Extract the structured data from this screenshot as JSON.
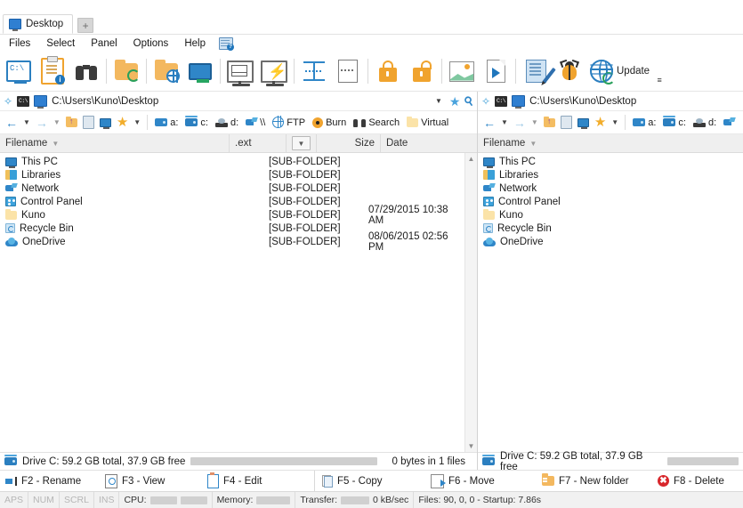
{
  "window": {
    "tab_label": "Desktop",
    "new_tab_label": "+"
  },
  "menu": {
    "items": [
      {
        "label": "Files",
        "name": "menu-files"
      },
      {
        "label": "Select",
        "name": "menu-select"
      },
      {
        "label": "Panel",
        "name": "menu-panel"
      },
      {
        "label": "Options",
        "name": "menu-options"
      },
      {
        "label": "Help",
        "name": "menu-help"
      }
    ],
    "help_icon": "help-sheet-icon"
  },
  "toolbar": {
    "update_label": "Update",
    "overflow_label": "≡",
    "buttons": [
      {
        "name": "command-prompt-button",
        "icon": "command-prompt-icon",
        "label": "C:\\"
      },
      {
        "name": "clipboard-info-button",
        "icon": "clipboard-info-icon"
      },
      {
        "name": "binoculars-search-button",
        "icon": "binoculars-icon"
      },
      {
        "name": "folder-sync-button",
        "icon": "folder-sync-icon"
      },
      {
        "name": "folder-network-button",
        "icon": "folder-globe-icon"
      },
      {
        "name": "network-computer-button",
        "icon": "monitor-network-icon"
      },
      {
        "name": "pack-mail-button",
        "icon": "envelope-clamp-icon"
      },
      {
        "name": "pack-fast-button",
        "icon": "bolt-clamp-icon"
      },
      {
        "name": "split-file-button",
        "icon": "split-horizontal-icon"
      },
      {
        "name": "combine-file-button",
        "icon": "combine-document-icon"
      },
      {
        "name": "encrypt-button",
        "icon": "lock-closed-icon"
      },
      {
        "name": "decrypt-button",
        "icon": "lock-open-icon"
      },
      {
        "name": "image-viewer-button",
        "icon": "picture-icon"
      },
      {
        "name": "media-player-button",
        "icon": "page-play-icon"
      },
      {
        "name": "editor-button",
        "icon": "document-pencil-icon"
      },
      {
        "name": "debug-button",
        "icon": "bug-icon"
      },
      {
        "name": "update-button",
        "icon": "globe-refresh-icon"
      }
    ]
  },
  "panels": {
    "left": {
      "address": {
        "path": "C:\\Users\\Kuno\\Desktop",
        "cmd_badge": "C:\\",
        "dropdown_icon": "chevron-down-icon",
        "favorite_icon": "star-icon",
        "search_icon": "magnifier-icon"
      },
      "nav": {
        "back_icon": "arrow-left-icon",
        "forward_icon": "arrow-right-icon",
        "up_icon": "folder-up-icon",
        "same_icon": "copy-path-icon",
        "desktop_icon": "monitor-icon",
        "favorites_icon": "star-icon"
      },
      "drives": [
        {
          "label": "a:",
          "icon": "floppy-drive-icon",
          "name": "drive-a-button"
        },
        {
          "label": "c:",
          "icon": "hard-drive-icon",
          "name": "drive-c-button"
        },
        {
          "label": "d:",
          "icon": "cd-drive-icon",
          "name": "drive-d-button"
        },
        {
          "label": "\\\\",
          "icon": "network-plug-icon",
          "name": "network-button"
        },
        {
          "label": "FTP",
          "icon": "globe-icon",
          "name": "ftp-button"
        },
        {
          "label": "Burn",
          "icon": "burn-disc-icon",
          "name": "burn-button"
        },
        {
          "label": "Search",
          "icon": "binoculars-icon",
          "name": "search-button"
        },
        {
          "label": "Virtual",
          "icon": "folder-virtual-icon",
          "name": "virtual-button"
        }
      ],
      "columns": [
        {
          "label": "Filename",
          "name": "column-filename",
          "sorted": true
        },
        {
          "label": ".ext",
          "name": "column-ext"
        },
        {
          "label": "",
          "name": "column-picker"
        },
        {
          "label": "Size",
          "name": "column-size"
        },
        {
          "label": "Date",
          "name": "column-date"
        }
      ],
      "rows": [
        {
          "name": "This PC",
          "ext": "",
          "size": "[SUB-FOLDER]",
          "date": "",
          "icon": "this-pc-icon"
        },
        {
          "name": "Libraries",
          "ext": "",
          "size": "[SUB-FOLDER]",
          "date": "",
          "icon": "libraries-icon"
        },
        {
          "name": "Network",
          "ext": "",
          "size": "[SUB-FOLDER]",
          "date": "",
          "icon": "network-icon"
        },
        {
          "name": "Control Panel",
          "ext": "",
          "size": "[SUB-FOLDER]",
          "date": "",
          "icon": "control-panel-icon"
        },
        {
          "name": "Kuno",
          "ext": "",
          "size": "[SUB-FOLDER]",
          "date": "07/29/2015 10:38 AM",
          "icon": "folder-icon"
        },
        {
          "name": "Recycle Bin",
          "ext": "",
          "size": "[SUB-FOLDER]",
          "date": "",
          "icon": "recycle-bin-icon"
        },
        {
          "name": "OneDrive",
          "ext": "",
          "size": "[SUB-FOLDER]",
          "date": "08/06/2015 02:56 PM",
          "icon": "onedrive-icon"
        }
      ],
      "drive_status": "Drive C: 59.2 GB total, 37.9 GB free",
      "selection_status": "0 bytes in 1 files",
      "scroll_up_icon": "chevron-up-icon",
      "scroll_down_icon": "chevron-down-icon"
    },
    "right": {
      "address": {
        "path": "C:\\Users\\Kuno\\Desktop",
        "cmd_badge": "C:\\",
        "favorite_icon": "star-icon"
      },
      "drives": [
        {
          "label": "a:",
          "icon": "floppy-drive-icon",
          "name": "drive-a-button"
        },
        {
          "label": "c:",
          "icon": "hard-drive-icon",
          "name": "drive-c-button"
        },
        {
          "label": "d:",
          "icon": "cd-drive-icon",
          "name": "drive-d-button"
        },
        {
          "label": "",
          "icon": "network-plug-icon",
          "name": "network-button"
        }
      ],
      "columns": [
        {
          "label": "Filename",
          "name": "column-filename",
          "sorted": true
        }
      ],
      "rows": [
        {
          "name": "This PC",
          "icon": "this-pc-icon"
        },
        {
          "name": "Libraries",
          "icon": "libraries-icon"
        },
        {
          "name": "Network",
          "icon": "network-icon"
        },
        {
          "name": "Control Panel",
          "icon": "control-panel-icon"
        },
        {
          "name": "Kuno",
          "icon": "folder-icon"
        },
        {
          "name": "Recycle Bin",
          "icon": "recycle-bin-icon"
        },
        {
          "name": "OneDrive",
          "icon": "onedrive-icon"
        }
      ],
      "drive_status": "Drive C: 59.2 GB total, 37.9 GB free"
    }
  },
  "function_keys": [
    {
      "label": "F2 - Rename",
      "name": "fkey-f2-rename",
      "icon": "rename-icon"
    },
    {
      "label": "F3 - View",
      "name": "fkey-f3-view",
      "icon": "view-icon"
    },
    {
      "label": "F4 - Edit",
      "name": "fkey-f4-edit",
      "icon": "edit-icon"
    },
    {
      "label": "F5 - Copy",
      "name": "fkey-f5-copy",
      "icon": "copy-icon"
    },
    {
      "label": "F6 - Move",
      "name": "fkey-f6-move",
      "icon": "move-icon"
    },
    {
      "label": "F7 - New folder",
      "name": "fkey-f7-new-folder",
      "icon": "new-folder-icon"
    },
    {
      "label": "F8 - Delete",
      "name": "fkey-f8-delete",
      "icon": "delete-icon"
    }
  ],
  "status_bar": {
    "caps": "APS",
    "num": "NUM",
    "scrl": "SCRL",
    "ins": "INS",
    "cpu_label": "CPU:",
    "memory_label": "Memory:",
    "transfer_label": "Transfer:",
    "transfer_rate": "0 kB/sec",
    "files_info": "Files: 90, 0, 0 - Startup: 7.86s"
  },
  "colors": {
    "accent_blue": "#2f86c8",
    "accent_orange": "#f0a32e",
    "header_gray": "#efefef",
    "status_gray": "#f1f1f1",
    "delete_red": "#d8262b",
    "green": "#29a05b"
  }
}
